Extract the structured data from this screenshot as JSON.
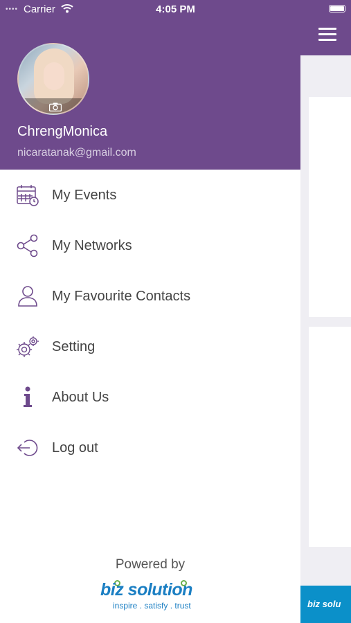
{
  "status_bar": {
    "carrier": "Carrier",
    "time": "4:05 PM"
  },
  "profile": {
    "name": "ChrengMonica",
    "email": "nicaratanak@gmail.com"
  },
  "menu": [
    {
      "label": "My Events",
      "icon": "calendar-icon"
    },
    {
      "label": "My Networks",
      "icon": "share-icon"
    },
    {
      "label": "My Favourite Contacts",
      "icon": "person-icon"
    },
    {
      "label": "Setting",
      "icon": "gear-icon"
    },
    {
      "label": "About Us",
      "icon": "info-icon"
    },
    {
      "label": "Log out",
      "icon": "logout-icon"
    }
  ],
  "footer": {
    "powered_by": "Powered by",
    "brand": "biz solution",
    "tagline": "inspire . satisfy . trust"
  },
  "banner": {
    "text": "biz solu"
  },
  "colors": {
    "header": "#6e4a8c",
    "icon": "#6e4a8c",
    "logo": "#1b7fc3"
  }
}
